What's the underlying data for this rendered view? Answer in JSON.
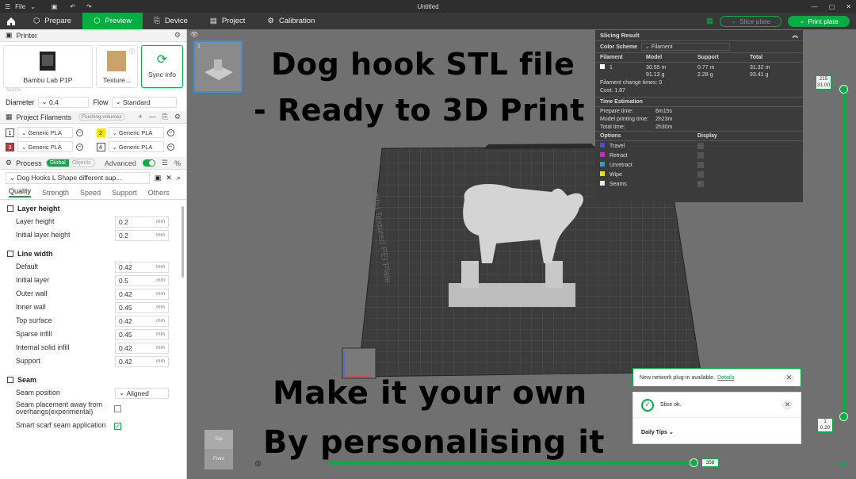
{
  "window": {
    "title": "Untitled",
    "file_menu": "File"
  },
  "nav": {
    "tabs": [
      "Prepare",
      "Preview",
      "Device",
      "Project",
      "Calibration"
    ],
    "active_tab": "Preview",
    "slice_plate": "Slice plate",
    "print_plate": "Print plate"
  },
  "sidebar": {
    "printer_header": "Printer",
    "printer_name": "Bambu Lab P1P",
    "plate_name": "Texture...",
    "sync_label": "Sync info",
    "nozzle_label": "Nozzle",
    "diameter_label": "Diameter",
    "diameter_value": "0.4",
    "flow_label": "Flow",
    "flow_value": "Standard",
    "filaments_header": "Project Filaments",
    "flushing_label": "Flushing volumes",
    "filaments": [
      {
        "num": "1",
        "name": "Generic PLA",
        "color": "#ffffff"
      },
      {
        "num": "2",
        "name": "Generic PLA",
        "color": "#f5e400"
      },
      {
        "num": "3",
        "name": "Generic PLA",
        "color": "#b33a3a"
      },
      {
        "num": "4",
        "name": "Generic PLA",
        "color": "#ffffff"
      }
    ],
    "process_header": "Process",
    "process_global": "Global",
    "process_objects": "Objects",
    "advanced_label": "Advanced",
    "preset_name": "Dog Hooks L Shape different sup...",
    "quality_tabs": [
      "Quality",
      "Strength",
      "Speed",
      "Support",
      "Others"
    ],
    "groups": {
      "layer_height": {
        "title": "Layer height",
        "rows": [
          {
            "label": "Layer height",
            "value": "0.2",
            "unit": "mm"
          },
          {
            "label": "Initial layer height",
            "value": "0.2",
            "unit": "mm"
          }
        ]
      },
      "line_width": {
        "title": "Line width",
        "rows": [
          {
            "label": "Default",
            "value": "0.42",
            "unit": "mm"
          },
          {
            "label": "Initial layer",
            "value": "0.5",
            "unit": "mm"
          },
          {
            "label": "Outer wall",
            "value": "0.42",
            "unit": "mm"
          },
          {
            "label": "Inner wall",
            "value": "0.45",
            "unit": "mm"
          },
          {
            "label": "Top surface",
            "value": "0.42",
            "unit": "mm"
          },
          {
            "label": "Sparse infill",
            "value": "0.45",
            "unit": "mm"
          },
          {
            "label": "Internal solid infill",
            "value": "0.42",
            "unit": "mm"
          },
          {
            "label": "Support",
            "value": "0.42",
            "unit": "mm"
          }
        ]
      },
      "seam": {
        "title": "Seam",
        "position_label": "Seam position",
        "position_value": "Aligned",
        "placement_label": "Seam placement away from overhangs(experimental)",
        "scarf_label": "Smart scarf seam application"
      }
    }
  },
  "overlay": {
    "line1": "Dog hook STL file",
    "line2": "- Ready to 3D Print",
    "line3": "Make it your own",
    "line4": "By personalising it"
  },
  "slicing_result": {
    "title": "Slicing Result",
    "color_scheme_label": "Color Scheme",
    "color_scheme_value": "Filament",
    "headers": [
      "Filament",
      "Model",
      "Support",
      "Total"
    ],
    "filament_row": {
      "id": "1",
      "model_m": "30.55 m",
      "model_g": "91.13 g",
      "support_m": "0.77 m",
      "support_g": "2.28 g",
      "total_m": "31.32 m",
      "total_g": "93.41 g"
    },
    "change_times_label": "Filament change times:",
    "change_times": "0",
    "cost_label": "Cost:",
    "cost": "1.87",
    "time_header": "Time Estimation",
    "prepare_label": "Prepare time:",
    "prepare_time": "6m15s",
    "model_time_label": "Model printing time:",
    "model_time": "2h23m",
    "total_time_label": "Total time:",
    "total_time": "2h30m",
    "options_label": "Options",
    "display_label": "Display",
    "options": [
      {
        "name": "Travel",
        "color": "#5050c8"
      },
      {
        "name": "Retract",
        "color": "#c030c0"
      },
      {
        "name": "Unretract",
        "color": "#30a0c0"
      },
      {
        "name": "Wipe",
        "color": "#e6e600"
      },
      {
        "name": "Seams",
        "color": "#e8e8e8"
      }
    ]
  },
  "layer_slider": {
    "top_layer": "215",
    "top_height": "31.00",
    "bottom_layer": "1",
    "bottom_height": "0.20"
  },
  "move_slider": {
    "value": "358"
  },
  "plate_text": "Bambu Textured PEI Plate",
  "notification": {
    "text": "New network plug-in available.",
    "link": "Details"
  },
  "slice_status": {
    "text": "Slice ok.",
    "tips": "Daily Tips"
  },
  "view_cube": {
    "top": "Top",
    "front": "Front"
  }
}
